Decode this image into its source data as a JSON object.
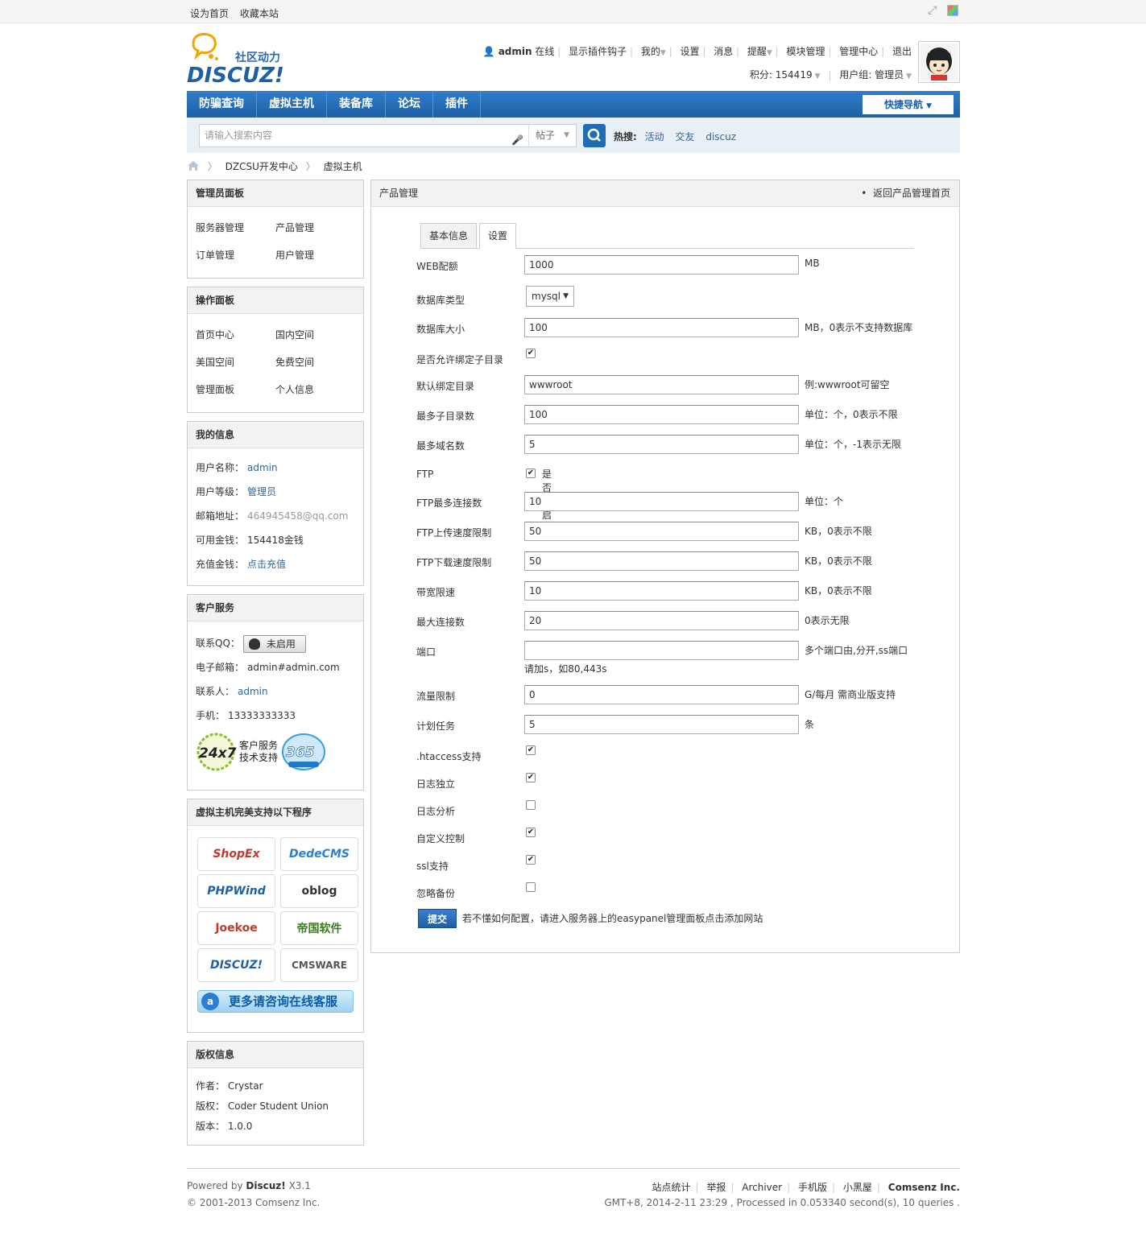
{
  "toptb": {
    "set_home": "设为首页",
    "bookmark": "收藏本站"
  },
  "logo": {
    "tagline": "社区动力",
    "word": "DISCUZ!"
  },
  "userbar": {
    "username": "admin",
    "online": "在线",
    "links": [
      "显示插件钩子",
      "我的",
      "设置",
      "消息",
      "提醒",
      "模块管理",
      "管理中心",
      "退出"
    ],
    "credits_label": "积分: 154419",
    "group_label": "用户组: 管理员"
  },
  "nav": {
    "items": [
      "防骗查询",
      "虚拟主机",
      "装备库",
      "论坛",
      "插件"
    ],
    "quick": "快捷导航"
  },
  "search": {
    "placeholder": "请输入搜索内容",
    "type": "帖子",
    "hot_label": "热搜:",
    "hot": [
      "活动",
      "交友",
      "discuz"
    ]
  },
  "breadcrumb": [
    "DZCSU开发中心",
    "虚拟主机"
  ],
  "admin_panel": {
    "title": "管理员面板",
    "items": [
      "服务器管理",
      "产品管理",
      "订单管理",
      "用户管理"
    ]
  },
  "op_panel": {
    "title": "操作面板",
    "items": [
      "首页中心",
      "国内空间",
      "美国空间",
      "免费空间",
      "管理面板",
      "个人信息"
    ]
  },
  "my_info": {
    "title": "我的信息",
    "rows": [
      {
        "label": "用户名称：",
        "value": "admin"
      },
      {
        "label": "用户等级：",
        "value": "管理员"
      },
      {
        "label": "邮箱地址：",
        "value": "464945458@qq.com"
      },
      {
        "label": "可用金钱：",
        "value": "154418金钱"
      },
      {
        "label": "充值金钱：",
        "value": "点击充值"
      }
    ]
  },
  "service": {
    "title": "客户服务",
    "qq_label": "联系QQ：",
    "qq_btn": "未启用",
    "email_label": "电子邮箱：",
    "email": "admin#admin.com",
    "contact_label": "联系人：",
    "contact": "admin",
    "phone_label": "手机：",
    "phone": "13333333333",
    "badge_247": "24x7",
    "badge_text1": "客户服务",
    "badge_text2": "技术支持",
    "badge_365": "365"
  },
  "programs": {
    "title": "虚拟主机完美支持以下程序",
    "items": [
      "ShopEx",
      "DedeCMS",
      "PHPWind",
      "oblog",
      "Joekoe",
      "帝国软件",
      "DISCUZ!",
      "CMSWARE"
    ],
    "more": "更多请咨询在线客服"
  },
  "copyright": {
    "title": "版权信息",
    "rows": [
      {
        "label": "作者：",
        "value": "Crystar"
      },
      {
        "label": "版权：",
        "value": "Coder Student Union"
      },
      {
        "label": "版本：",
        "value": "1.0.0"
      }
    ]
  },
  "main": {
    "title": "产品管理",
    "back": "返回产品管理首页",
    "tabs": [
      "基本信息",
      "设置"
    ],
    "fields": {
      "web_quota": {
        "label": "WEB配额",
        "value": "1000",
        "hint": "MB"
      },
      "db_type": {
        "label": "数据库类型",
        "value": "mysql"
      },
      "db_size": {
        "label": "数据库大小",
        "value": "100",
        "hint": "MB，0表示不支持数据库"
      },
      "allow_bind": {
        "label": "是否允许绑定子目录"
      },
      "default_dir": {
        "label": "默认绑定目录",
        "value": "wwwroot",
        "hint": "例:wwwroot可留空"
      },
      "max_subdir": {
        "label": "最多子目录数",
        "value": "100",
        "hint": "单位：个，0表示不限"
      },
      "max_domain": {
        "label": "最多域名数",
        "value": "5",
        "hint": "单位：个，-1表示无限"
      },
      "ftp": {
        "label": "FTP",
        "check_label": "是否开启FTP"
      },
      "ftp_conn": {
        "label": "FTP最多连接数",
        "value": "10",
        "hint": "单位：个"
      },
      "ftp_up": {
        "label": "FTP上传速度限制",
        "value": "50",
        "hint": "KB，0表示不限"
      },
      "ftp_down": {
        "label": "FTP下载速度限制",
        "value": "50",
        "hint": "KB，0表示不限"
      },
      "bandwidth": {
        "label": "带宽限速",
        "value": "10",
        "hint": "KB，0表示不限"
      },
      "max_conn": {
        "label": "最大连接数",
        "value": "20",
        "hint": "0表示无限"
      },
      "port": {
        "label": "端口",
        "value": "",
        "hint": "多个端口由,分开,ss端口",
        "subhint": "请加s，如80,443s"
      },
      "traffic": {
        "label": "流量限制",
        "value": "0",
        "hint": "G/每月 需商业版支持"
      },
      "cron": {
        "label": "计划任务",
        "value": "5",
        "hint": "条"
      },
      "htaccess": {
        "label": ".htaccess支持"
      },
      "log_sep": {
        "label": "日志独立"
      },
      "log_ana": {
        "label": "日志分析"
      },
      "custom_ctrl": {
        "label": "自定义控制"
      },
      "ssl": {
        "label": "ssl支持"
      },
      "ignore_backup": {
        "label": "忽略备份"
      }
    },
    "submit": "提交",
    "submit_hint": "若不懂如何配置，请进入服务器上的easypanel管理面板点击添加网站"
  },
  "footer": {
    "powered_prefix": "Powered by",
    "powered_name": "Discuz!",
    "powered_ver": "X3.1",
    "copyright": "© 2001-2013 Comsenz Inc.",
    "links": [
      "站点统计",
      "举报",
      "Archiver",
      "手机版",
      "小黑屋"
    ],
    "company": "Comsenz Inc.",
    "stats": "GMT+8, 2014-2-11 23:29 , Processed in 0.053340 second(s), 10 queries ."
  },
  "colors": {
    "nav_blue": "#1f5fa6",
    "link": "#336699"
  }
}
